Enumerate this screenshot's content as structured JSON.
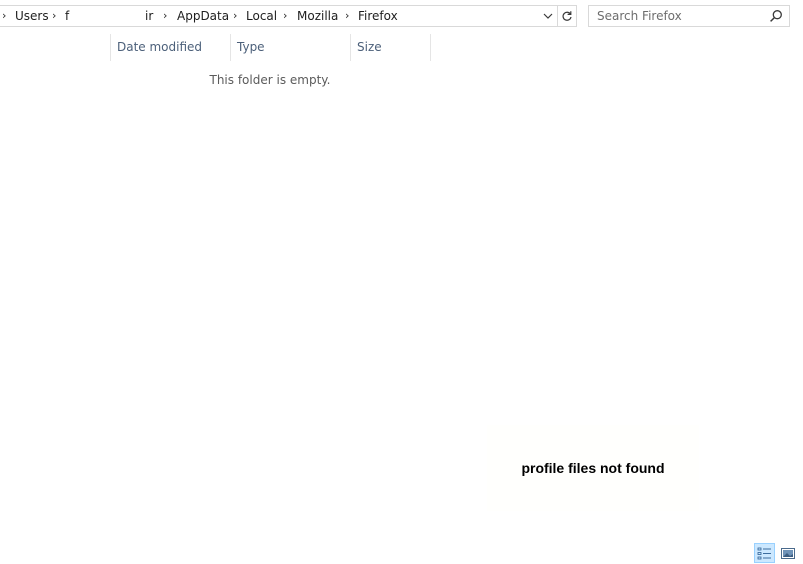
{
  "address_bar": {
    "crumbs": [
      "Users",
      "f",
      "ir",
      "AppData",
      "Local",
      "Mozilla",
      "Firefox"
    ],
    "separator": "›"
  },
  "search": {
    "placeholder": "Search Firefox"
  },
  "columns": [
    "Date modified",
    "Type",
    "Size"
  ],
  "content": {
    "empty_message": "This folder is empty."
  },
  "overlay": {
    "note": "profile files not found"
  },
  "view": {
    "active": "details",
    "buttons": [
      "details-view",
      "large-icons-view"
    ]
  },
  "colors": {
    "header_text": "#4c607a",
    "selected_view_bg": "#cce8ff",
    "selected_view_border": "#99d1ff",
    "border": "#d9d9d9"
  }
}
